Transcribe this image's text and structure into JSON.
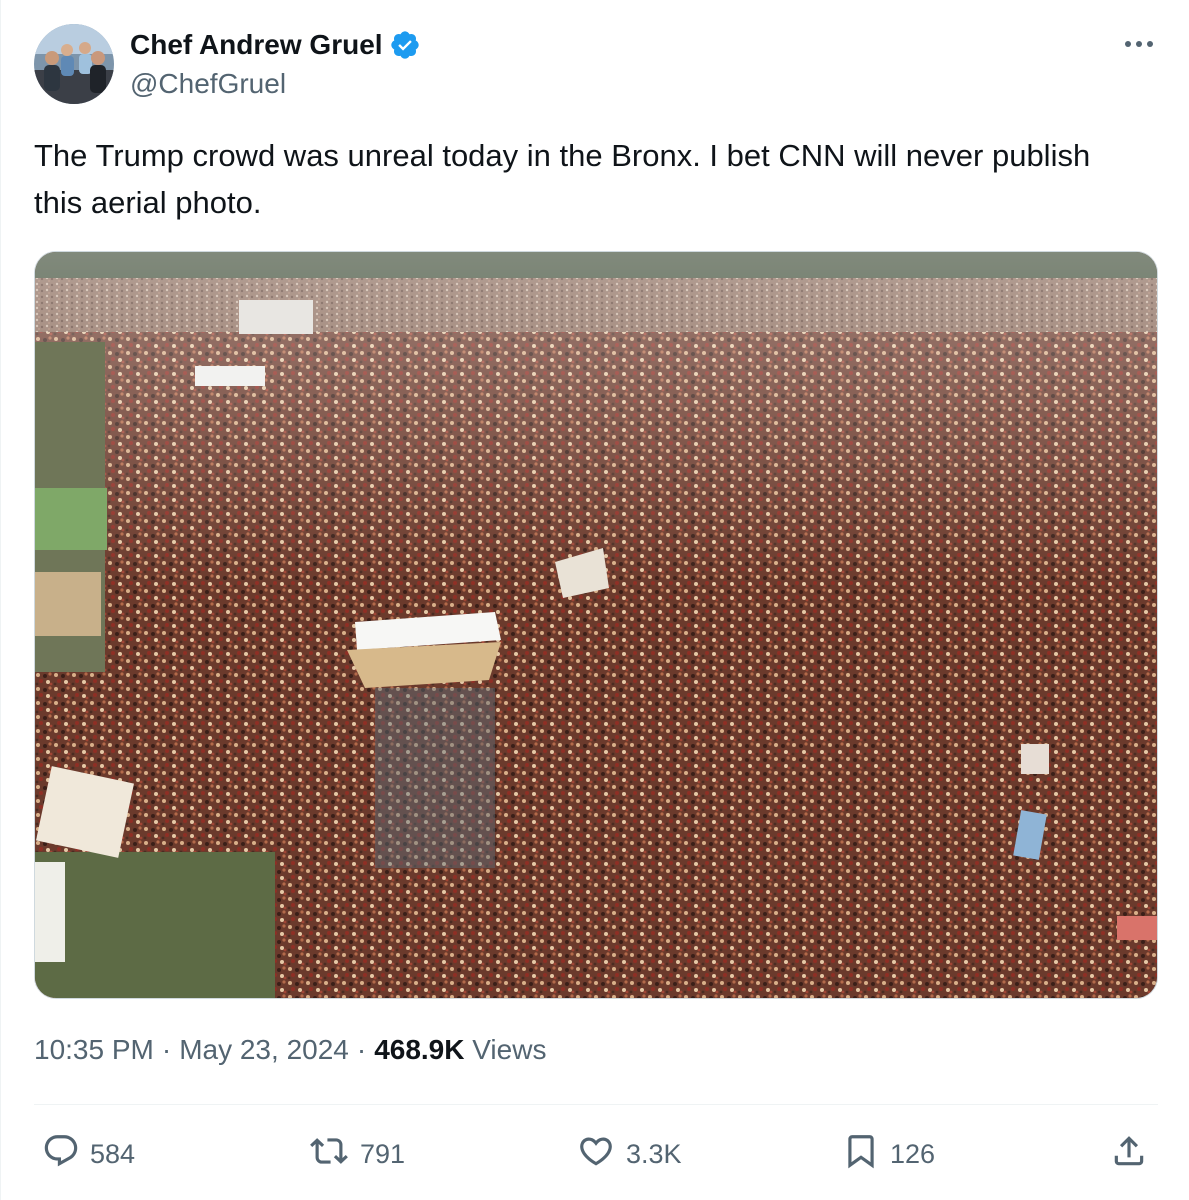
{
  "author": {
    "display_name": "Chef Andrew Gruel",
    "handle": "@ChefGruel",
    "verified_icon": "verified-badge-icon",
    "verified_color": "#1d9bf0"
  },
  "tweet": {
    "text": "The Trump crowd was unreal today in the Bronx. I bet CNN will never publish this aerial photo."
  },
  "meta": {
    "time": "10:35 PM",
    "separator": "·",
    "date": "May 23, 2024",
    "views_count": "468.9K",
    "views_label": "Views"
  },
  "actions": {
    "replies": {
      "icon": "reply-icon",
      "count": "584"
    },
    "retweets": {
      "icon": "retweet-icon",
      "count": "791"
    },
    "likes": {
      "icon": "heart-icon",
      "count": "3.3K"
    },
    "bookmarks": {
      "icon": "bookmark-icon",
      "count": "126"
    },
    "share": {
      "icon": "share-icon"
    }
  },
  "colors": {
    "text_primary": "#0f1419",
    "text_secondary": "#536471",
    "accent": "#1d9bf0",
    "border": "#cfd9de"
  }
}
